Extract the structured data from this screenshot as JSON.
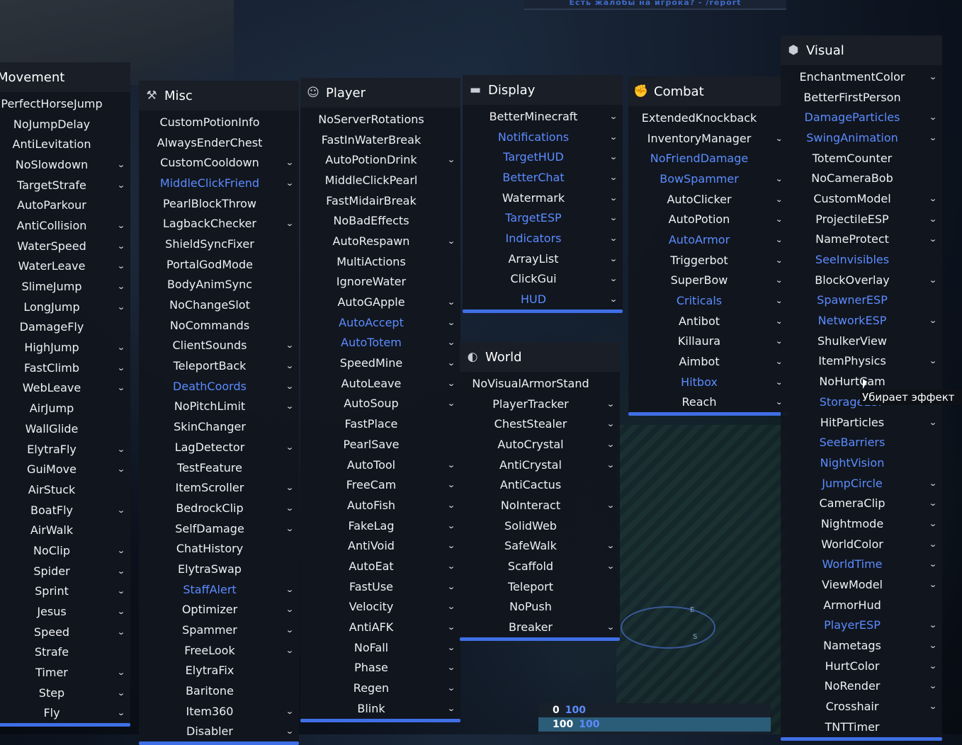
{
  "top_banner": "Есть жалобы на игрока? - /report",
  "tooltip": "Убирает эффект",
  "hud": {
    "row1": [
      "0",
      "100"
    ],
    "row2": [
      "100",
      "100"
    ]
  },
  "compass": {
    "e": "E",
    "s": "S"
  },
  "colors": {
    "accent": "#3f6fe6",
    "enabled_text": "#5b8cff",
    "panel_bg": "#12161e"
  },
  "panels": [
    {
      "key": "movement",
      "title": "Movement",
      "icon": "",
      "items": [
        {
          "label": "PerfectHorseJump",
          "on": false,
          "chev": false
        },
        {
          "label": "NoJumpDelay",
          "on": false,
          "chev": false
        },
        {
          "label": "AntiLevitation",
          "on": false,
          "chev": false
        },
        {
          "label": "NoSlowdown",
          "on": false,
          "chev": true
        },
        {
          "label": "TargetStrafe",
          "on": false,
          "chev": true
        },
        {
          "label": "AutoParkour",
          "on": false,
          "chev": false
        },
        {
          "label": "AntiCollision",
          "on": false,
          "chev": true
        },
        {
          "label": "WaterSpeed",
          "on": false,
          "chev": true
        },
        {
          "label": "WaterLeave",
          "on": false,
          "chev": true
        },
        {
          "label": "SlimeJump",
          "on": false,
          "chev": true
        },
        {
          "label": "LongJump",
          "on": false,
          "chev": true
        },
        {
          "label": "DamageFly",
          "on": false,
          "chev": false
        },
        {
          "label": "HighJump",
          "on": false,
          "chev": true
        },
        {
          "label": "FastClimb",
          "on": false,
          "chev": true
        },
        {
          "label": "WebLeave",
          "on": false,
          "chev": true
        },
        {
          "label": "AirJump",
          "on": false,
          "chev": false
        },
        {
          "label": "WallGlide",
          "on": false,
          "chev": false
        },
        {
          "label": "ElytraFly",
          "on": false,
          "chev": true
        },
        {
          "label": "GuiMove",
          "on": false,
          "chev": true
        },
        {
          "label": "AirStuck",
          "on": false,
          "chev": false
        },
        {
          "label": "BoatFly",
          "on": false,
          "chev": true
        },
        {
          "label": "AirWalk",
          "on": false,
          "chev": false
        },
        {
          "label": "NoClip",
          "on": false,
          "chev": true
        },
        {
          "label": "Spider",
          "on": false,
          "chev": true
        },
        {
          "label": "Sprint",
          "on": false,
          "chev": true
        },
        {
          "label": "Jesus",
          "on": false,
          "chev": true
        },
        {
          "label": "Speed",
          "on": false,
          "chev": true
        },
        {
          "label": "Strafe",
          "on": false,
          "chev": false
        },
        {
          "label": "Timer",
          "on": false,
          "chev": true
        },
        {
          "label": "Step",
          "on": false,
          "chev": true
        },
        {
          "label": "Fly",
          "on": false,
          "chev": true
        }
      ]
    },
    {
      "key": "misc",
      "title": "Misc",
      "icon": "hammer-icon",
      "items": [
        {
          "label": "CustomPotionInfo",
          "on": false,
          "chev": false
        },
        {
          "label": "AlwaysEnderChest",
          "on": false,
          "chev": false
        },
        {
          "label": "CustomCooldown",
          "on": false,
          "chev": true
        },
        {
          "label": "MiddleClickFriend",
          "on": true,
          "chev": true
        },
        {
          "label": "PearlBlockThrow",
          "on": false,
          "chev": false
        },
        {
          "label": "LagbackChecker",
          "on": false,
          "chev": true
        },
        {
          "label": "ShieldSyncFixer",
          "on": false,
          "chev": false
        },
        {
          "label": "PortalGodMode",
          "on": false,
          "chev": false
        },
        {
          "label": "BodyAnimSync",
          "on": false,
          "chev": false
        },
        {
          "label": "NoChangeSlot",
          "on": false,
          "chev": false
        },
        {
          "label": "NoCommands",
          "on": false,
          "chev": false
        },
        {
          "label": "ClientSounds",
          "on": false,
          "chev": true
        },
        {
          "label": "TeleportBack",
          "on": false,
          "chev": true
        },
        {
          "label": "DeathCoords",
          "on": true,
          "chev": true
        },
        {
          "label": "NoPitchLimit",
          "on": false,
          "chev": true
        },
        {
          "label": "SkinChanger",
          "on": false,
          "chev": false
        },
        {
          "label": "LagDetector",
          "on": false,
          "chev": true
        },
        {
          "label": "TestFeature",
          "on": false,
          "chev": false
        },
        {
          "label": "ItemScroller",
          "on": false,
          "chev": true
        },
        {
          "label": "BedrockClip",
          "on": false,
          "chev": true
        },
        {
          "label": "SelfDamage",
          "on": false,
          "chev": true
        },
        {
          "label": "ChatHistory",
          "on": false,
          "chev": false
        },
        {
          "label": "ElytraSwap",
          "on": false,
          "chev": false
        },
        {
          "label": "StaffAlert",
          "on": true,
          "chev": true
        },
        {
          "label": "Optimizer",
          "on": false,
          "chev": true
        },
        {
          "label": "Spammer",
          "on": false,
          "chev": true
        },
        {
          "label": "FreeLook",
          "on": false,
          "chev": true
        },
        {
          "label": "ElytraFix",
          "on": false,
          "chev": false
        },
        {
          "label": "Baritone",
          "on": false,
          "chev": false
        },
        {
          "label": "Item360",
          "on": false,
          "chev": true
        },
        {
          "label": "Disabler",
          "on": false,
          "chev": true
        }
      ]
    },
    {
      "key": "player",
      "title": "Player",
      "icon": "person-icon",
      "items": [
        {
          "label": "NoServerRotations",
          "on": false,
          "chev": false
        },
        {
          "label": "FastInWaterBreak",
          "on": false,
          "chev": false
        },
        {
          "label": "AutoPotionDrink",
          "on": false,
          "chev": true
        },
        {
          "label": "MiddleClickPearl",
          "on": false,
          "chev": false
        },
        {
          "label": "FastMidairBreak",
          "on": false,
          "chev": false
        },
        {
          "label": "NoBadEffects",
          "on": false,
          "chev": false
        },
        {
          "label": "AutoRespawn",
          "on": false,
          "chev": true
        },
        {
          "label": "MultiActions",
          "on": false,
          "chev": false
        },
        {
          "label": "IgnoreWater",
          "on": false,
          "chev": false
        },
        {
          "label": "AutoGApple",
          "on": false,
          "chev": true
        },
        {
          "label": "AutoAccept",
          "on": true,
          "chev": true
        },
        {
          "label": "AutoTotem",
          "on": true,
          "chev": true
        },
        {
          "label": "SpeedMine",
          "on": false,
          "chev": true
        },
        {
          "label": "AutoLeave",
          "on": false,
          "chev": true
        },
        {
          "label": "AutoSoup",
          "on": false,
          "chev": true
        },
        {
          "label": "FastPlace",
          "on": false,
          "chev": false
        },
        {
          "label": "PearlSave",
          "on": false,
          "chev": false
        },
        {
          "label": "AutoTool",
          "on": false,
          "chev": true
        },
        {
          "label": "FreeCam",
          "on": false,
          "chev": true
        },
        {
          "label": "AutoFish",
          "on": false,
          "chev": true
        },
        {
          "label": "FakeLag",
          "on": false,
          "chev": true
        },
        {
          "label": "AntiVoid",
          "on": false,
          "chev": true
        },
        {
          "label": "AutoEat",
          "on": false,
          "chev": true
        },
        {
          "label": "FastUse",
          "on": false,
          "chev": true
        },
        {
          "label": "Velocity",
          "on": false,
          "chev": true
        },
        {
          "label": "AntiAFK",
          "on": false,
          "chev": true
        },
        {
          "label": "NoFall",
          "on": false,
          "chev": true
        },
        {
          "label": "Phase",
          "on": false,
          "chev": true
        },
        {
          "label": "Regen",
          "on": false,
          "chev": true
        },
        {
          "label": "Blink",
          "on": false,
          "chev": true
        }
      ]
    },
    {
      "key": "display",
      "title": "Display",
      "icon": "monitor-icon",
      "items": [
        {
          "label": "BetterMinecraft",
          "on": false,
          "chev": true
        },
        {
          "label": "Notifications",
          "on": true,
          "chev": true
        },
        {
          "label": "TargetHUD",
          "on": true,
          "chev": true
        },
        {
          "label": "BetterChat",
          "on": true,
          "chev": true
        },
        {
          "label": "Watermark",
          "on": false,
          "chev": true
        },
        {
          "label": "TargetESP",
          "on": true,
          "chev": true
        },
        {
          "label": "Indicators",
          "on": true,
          "chev": true
        },
        {
          "label": "ArrayList",
          "on": false,
          "chev": true
        },
        {
          "label": "ClickGui",
          "on": false,
          "chev": true
        },
        {
          "label": "HUD",
          "on": true,
          "chev": true
        }
      ]
    },
    {
      "key": "world",
      "title": "World",
      "icon": "planet-icon",
      "items": [
        {
          "label": "NoVisualArmorStand",
          "on": false,
          "chev": false
        },
        {
          "label": "PlayerTracker",
          "on": false,
          "chev": true
        },
        {
          "label": "ChestStealer",
          "on": false,
          "chev": true
        },
        {
          "label": "AutoCrystal",
          "on": false,
          "chev": true
        },
        {
          "label": "AntiCrystal",
          "on": false,
          "chev": true
        },
        {
          "label": "AntiCactus",
          "on": false,
          "chev": false
        },
        {
          "label": "NoInteract",
          "on": false,
          "chev": true
        },
        {
          "label": "SolidWeb",
          "on": false,
          "chev": false
        },
        {
          "label": "SafeWalk",
          "on": false,
          "chev": true
        },
        {
          "label": "Scaffold",
          "on": false,
          "chev": true
        },
        {
          "label": "Teleport",
          "on": false,
          "chev": false
        },
        {
          "label": "NoPush",
          "on": false,
          "chev": false
        },
        {
          "label": "Breaker",
          "on": false,
          "chev": true
        }
      ]
    },
    {
      "key": "combat",
      "title": "Combat",
      "icon": "fist-icon",
      "items": [
        {
          "label": "ExtendedKnockback",
          "on": false,
          "chev": false
        },
        {
          "label": "InventoryManager",
          "on": false,
          "chev": true
        },
        {
          "label": "NoFriendDamage",
          "on": true,
          "chev": false
        },
        {
          "label": "BowSpammer",
          "on": true,
          "chev": true
        },
        {
          "label": "AutoClicker",
          "on": false,
          "chev": true
        },
        {
          "label": "AutoPotion",
          "on": false,
          "chev": true
        },
        {
          "label": "AutoArmor",
          "on": true,
          "chev": true
        },
        {
          "label": "Triggerbot",
          "on": false,
          "chev": true
        },
        {
          "label": "SuperBow",
          "on": false,
          "chev": true
        },
        {
          "label": "Criticals",
          "on": true,
          "chev": true
        },
        {
          "label": "Antibot",
          "on": false,
          "chev": true
        },
        {
          "label": "Killaura",
          "on": false,
          "chev": true
        },
        {
          "label": "Aimbot",
          "on": false,
          "chev": true
        },
        {
          "label": "Hitbox",
          "on": true,
          "chev": true
        },
        {
          "label": "Reach",
          "on": false,
          "chev": true
        }
      ]
    },
    {
      "key": "visual",
      "title": "Visual",
      "icon": "hexagon-icon",
      "items": [
        {
          "label": "EnchantmentColor",
          "on": false,
          "chev": true
        },
        {
          "label": "BetterFirstPerson",
          "on": false,
          "chev": false
        },
        {
          "label": "DamageParticles",
          "on": true,
          "chev": true
        },
        {
          "label": "SwingAnimation",
          "on": true,
          "chev": true
        },
        {
          "label": "TotemCounter",
          "on": false,
          "chev": false
        },
        {
          "label": "NoCameraBob",
          "on": false,
          "chev": false
        },
        {
          "label": "CustomModel",
          "on": false,
          "chev": true
        },
        {
          "label": "ProjectileESP",
          "on": false,
          "chev": true
        },
        {
          "label": "NameProtect",
          "on": false,
          "chev": true
        },
        {
          "label": "SeeInvisibles",
          "on": true,
          "chev": false
        },
        {
          "label": "BlockOverlay",
          "on": false,
          "chev": true
        },
        {
          "label": "SpawnerESP",
          "on": true,
          "chev": false
        },
        {
          "label": "NetworkESP",
          "on": true,
          "chev": true
        },
        {
          "label": "ShulkerView",
          "on": false,
          "chev": false
        },
        {
          "label": "ItemPhysics",
          "on": false,
          "chev": true
        },
        {
          "label": "NoHurtCam",
          "on": false,
          "chev": false
        },
        {
          "label": "StorageESP",
          "on": true,
          "chev": false
        },
        {
          "label": "HitParticles",
          "on": false,
          "chev": true
        },
        {
          "label": "SeeBarriers",
          "on": true,
          "chev": false
        },
        {
          "label": "NightVision",
          "on": true,
          "chev": false
        },
        {
          "label": "JumpCircle",
          "on": true,
          "chev": true
        },
        {
          "label": "CameraClip",
          "on": false,
          "chev": true
        },
        {
          "label": "Nightmode",
          "on": false,
          "chev": true
        },
        {
          "label": "WorldColor",
          "on": false,
          "chev": true
        },
        {
          "label": "WorldTime",
          "on": true,
          "chev": true
        },
        {
          "label": "ViewModel",
          "on": false,
          "chev": true
        },
        {
          "label": "ArmorHud",
          "on": false,
          "chev": false
        },
        {
          "label": "PlayerESP",
          "on": true,
          "chev": true
        },
        {
          "label": "Nametags",
          "on": false,
          "chev": true
        },
        {
          "label": "HurtColor",
          "on": false,
          "chev": true
        },
        {
          "label": "NoRender",
          "on": false,
          "chev": true
        },
        {
          "label": "Crosshair",
          "on": false,
          "chev": true
        },
        {
          "label": "TNTTimer",
          "on": false,
          "chev": false
        }
      ]
    }
  ]
}
